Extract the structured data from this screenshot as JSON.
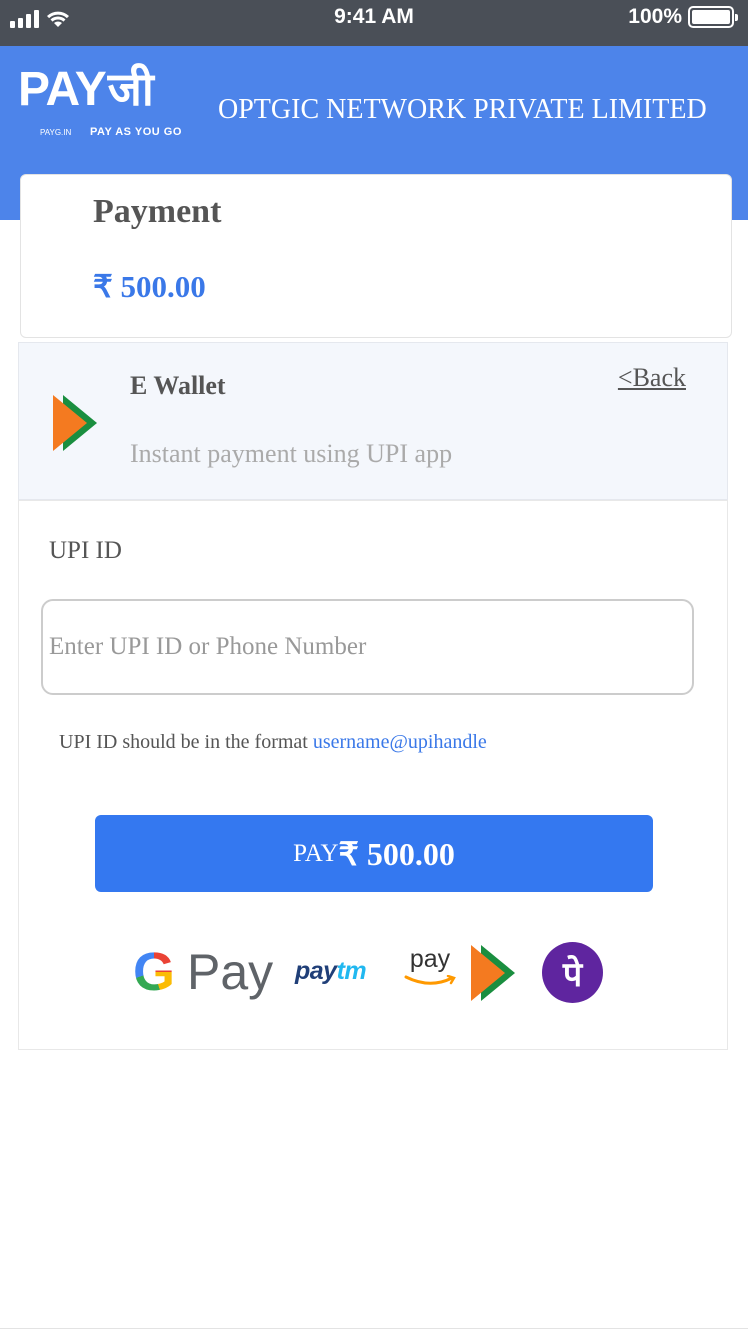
{
  "status_bar": {
    "time": "9:41 AM",
    "battery": "100%"
  },
  "header": {
    "logo": {
      "text": "PAY",
      "ji": "जी",
      "sub1": "PAYG.IN",
      "sub2": "PAY AS YOU GO"
    },
    "company": "OPTGIC NETWORK PRIVATE LIMITED"
  },
  "payment": {
    "title": "Payment",
    "amount": "₹ 500.00"
  },
  "wallet": {
    "title": "E Wallet",
    "subtitle": "Instant payment using UPI app",
    "back_label": "<Back"
  },
  "form": {
    "upi_label": "UPI ID",
    "upi_placeholder": "Enter UPI ID or Phone Number",
    "hint": "UPI ID should be in the format",
    "hint_format": "username@upihandle",
    "pay_label": "PAY",
    "pay_amount": "₹ 500.00"
  },
  "apps": {
    "gpay_g": "G",
    "gpay_text": "Pay",
    "paytm_a": "pay",
    "paytm_b": "tm",
    "amazon_pay": "pay",
    "phonepe": "पे"
  },
  "colors": {
    "header": "#4d84ea",
    "accent": "#3478f0",
    "upi_orange": "#f47a20",
    "upi_green": "#1a8e3f",
    "phonepe": "#5f259f"
  }
}
